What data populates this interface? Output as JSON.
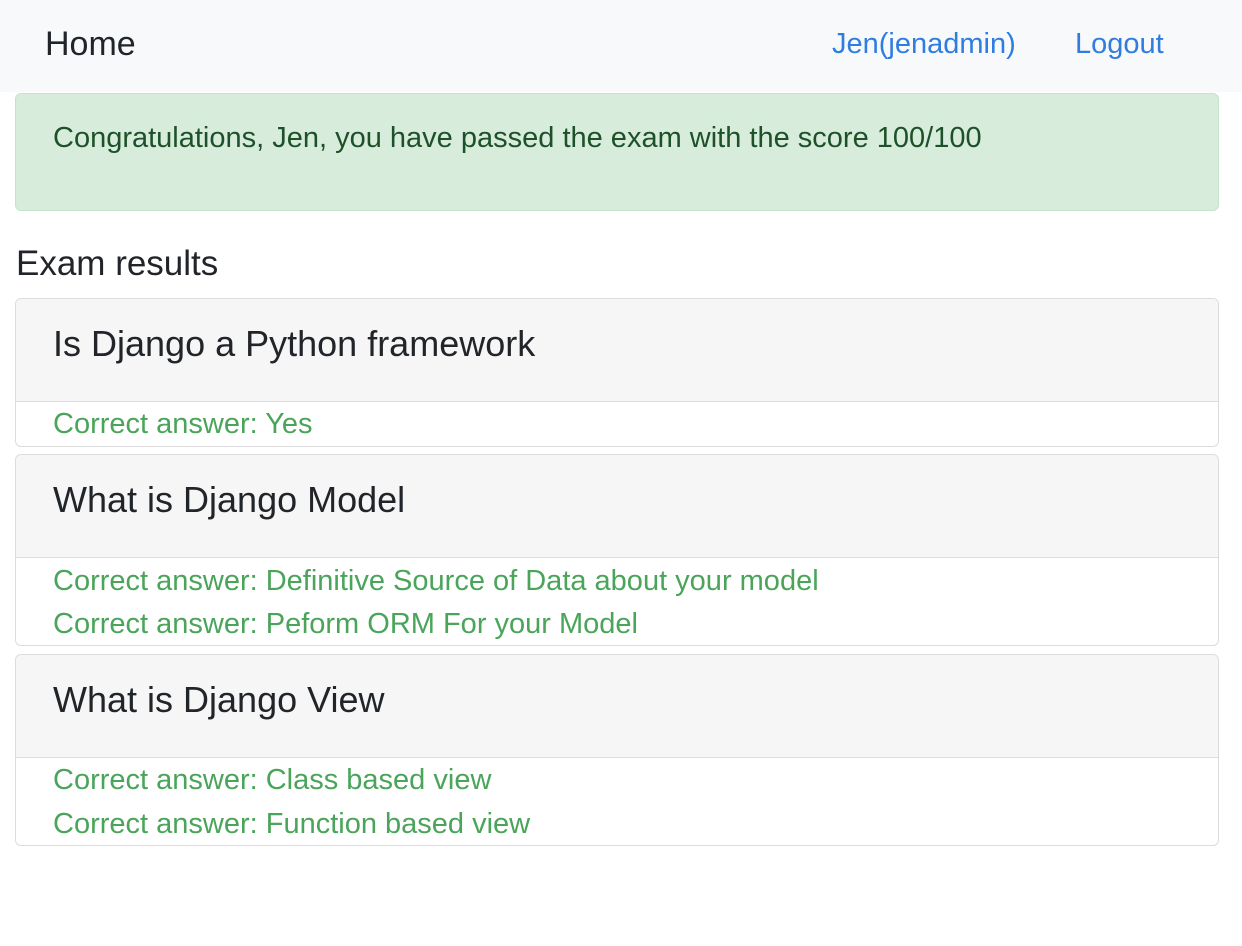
{
  "navbar": {
    "brand": "Home",
    "user_link": "Jen(jenadmin)",
    "logout_link": "Logout"
  },
  "alert": {
    "message": "Congratulations, Jen, you have passed the exam with the score 100/100"
  },
  "results": {
    "title": "Exam results",
    "questions": [
      {
        "text": "Is Django a Python framework",
        "answers": [
          "Correct answer: Yes"
        ]
      },
      {
        "text": "What is Django Model",
        "answers": [
          "Correct answer: Definitive Source of Data about your model",
          "Correct answer: Peform ORM For your Model"
        ]
      },
      {
        "text": "What is Django View",
        "answers": [
          "Correct answer: Class based view",
          "Correct answer: Function based view"
        ]
      }
    ]
  },
  "colors": {
    "navbar_bg": "#f8f9fa",
    "link": "#2f7de1",
    "alert_bg": "#d8ecdc",
    "alert_text": "#1d5129",
    "correct_answer": "#4aa45a"
  }
}
